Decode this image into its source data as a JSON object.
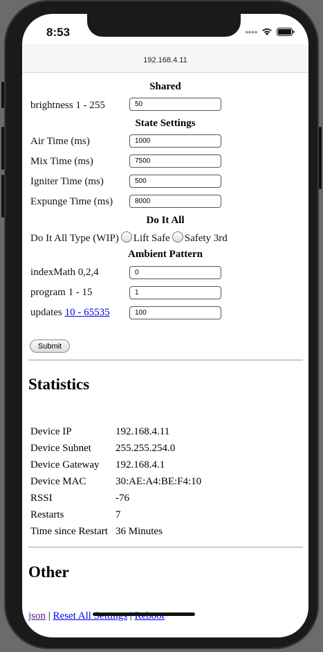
{
  "status": {
    "time": "8:53"
  },
  "browser": {
    "address": "192.168.4.11"
  },
  "form": {
    "shared": {
      "heading": "Shared",
      "brightness": {
        "label": "brightness 1 - 255",
        "value": "50"
      }
    },
    "state": {
      "heading": "State Settings",
      "air": {
        "label": "Air Time (ms)",
        "value": "1000"
      },
      "mix": {
        "label": "Mix Time (ms)",
        "value": "7500"
      },
      "igniter": {
        "label": "Igniter Time (ms)",
        "value": "500"
      },
      "expunge": {
        "label": "Expunge Time (ms)",
        "value": "8000"
      }
    },
    "doitall": {
      "heading": "Do It All",
      "type_label": "Do It All Type (WIP)",
      "options": [
        "Lift Safe",
        "Safety 3rd"
      ]
    },
    "ambient": {
      "heading": "Ambient Pattern",
      "indexmath": {
        "label": "indexMath 0,2,4",
        "value": "0"
      },
      "program": {
        "label": "program 1 - 15",
        "value": "1"
      },
      "updates": {
        "label": "updates",
        "link": "10 - 65535",
        "value": "100"
      }
    },
    "submit_label": "Submit"
  },
  "statistics": {
    "heading": "Statistics",
    "rows": [
      {
        "label": "Device IP",
        "value": "192.168.4.11"
      },
      {
        "label": "Device Subnet",
        "value": "255.255.254.0"
      },
      {
        "label": "Device Gateway",
        "value": "192.168.4.1"
      },
      {
        "label": "Device MAC",
        "value": "30:AE:A4:BE:F4:10"
      },
      {
        "label": "RSSI",
        "value": "-76"
      },
      {
        "label": "Restarts",
        "value": "7"
      },
      {
        "label": "Time since Restart",
        "value": "36 Minutes"
      }
    ]
  },
  "other": {
    "heading": "Other",
    "links": [
      "json",
      "Reset All Settings",
      "Reboot"
    ],
    "separator": "|"
  }
}
